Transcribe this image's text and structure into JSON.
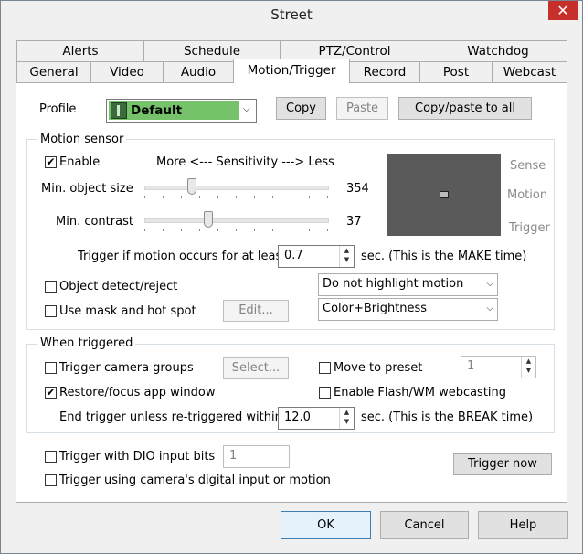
{
  "window": {
    "title": "Street",
    "close_glyph": "✕"
  },
  "tabs_top": [
    "Alerts",
    "Schedule",
    "PTZ/Control",
    "Watchdog"
  ],
  "tabs_bottom": [
    "General",
    "Video",
    "Audio",
    "Motion/Trigger",
    "Record",
    "Post",
    "Webcast"
  ],
  "selected_tab": "Motion/Trigger",
  "profile": {
    "label": "Profile",
    "value": "Default",
    "color": "#76c26a",
    "copy": "Copy",
    "paste": "Paste",
    "copy_all": "Copy/paste to all"
  },
  "motion_sensor": {
    "title": "Motion sensor",
    "enable_label": "Enable",
    "enable_checked": true,
    "sensitivity_label": "More <--- Sensitivity ---> Less",
    "min_object_size_label": "Min. object size",
    "min_object_size_value": "354",
    "min_object_size_fraction": 0.26,
    "min_contrast_label": "Min. contrast",
    "min_contrast_value": "37",
    "min_contrast_fraction": 0.35,
    "sense_labels": [
      "Sense",
      "Motion",
      "Trigger"
    ],
    "trigger_label": "Trigger if motion occurs for at least",
    "trigger_value": "0.7",
    "trigger_suffix": "sec.  (This is the MAKE time)",
    "object_detect_label": "Object detect/reject",
    "object_detect_checked": false,
    "highlight_select": "Do not highlight motion",
    "mask_label": "Use mask and hot spot",
    "mask_checked": false,
    "edit_button": "Edit...",
    "algorithm_select": "Color+Brightness"
  },
  "when_triggered": {
    "title": "When triggered",
    "camera_groups_label": "Trigger camera groups",
    "camera_groups_checked": false,
    "select_button": "Select...",
    "move_preset_label": "Move to preset",
    "move_preset_checked": false,
    "preset_value": "1",
    "restore_label": "Restore/focus app window",
    "restore_checked": true,
    "flash_label": "Enable Flash/WM webcasting",
    "flash_checked": false,
    "end_trigger_label": "End trigger unless re-triggered within",
    "end_trigger_value": "12.0",
    "end_trigger_suffix": "sec.  (This is the BREAK time)"
  },
  "dio": {
    "dio_label": "Trigger with DIO input bits",
    "dio_checked": false,
    "dio_value": "1",
    "digital_input_label": "Trigger using camera's digital input or motion",
    "digital_input_checked": false,
    "trigger_now": "Trigger now"
  },
  "footer": {
    "ok": "OK",
    "cancel": "Cancel",
    "help": "Help"
  },
  "check_glyph": "✔"
}
